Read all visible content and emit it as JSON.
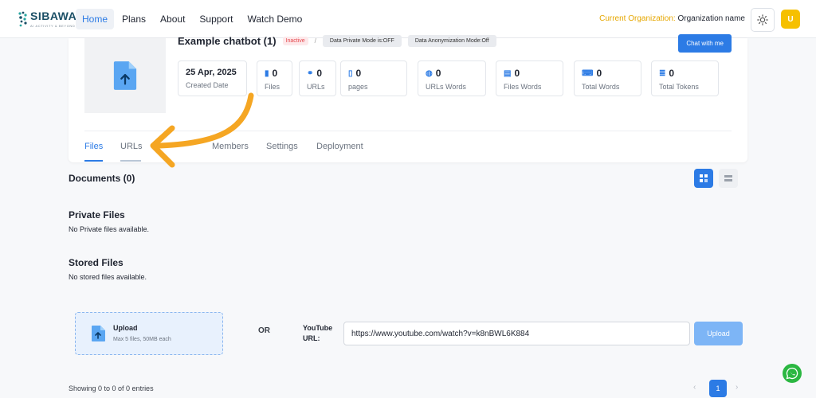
{
  "brand": {
    "name": "SIBAWAY",
    "tagline": "AI ACTIVITY & BEYOND"
  },
  "nav": [
    "Home",
    "Plans",
    "About",
    "Support",
    "Watch Demo"
  ],
  "nav_active": "Home",
  "org": {
    "label": "Current Organization:",
    "name": "Organization name"
  },
  "avatar": "U",
  "bot": {
    "title": "Example chatbot (1)",
    "status": "Inactive",
    "separator": "/",
    "private_mode": "Data Private Mode is:OFF",
    "anonymization": "Data Anonymization Mode:Off",
    "chat_button": "Chat with me"
  },
  "stats": [
    {
      "value": "25 Apr, 2025",
      "label": "Created Date",
      "icon": ""
    },
    {
      "value": "0",
      "label": "Files",
      "icon": "file-icon"
    },
    {
      "value": "0",
      "label": "URLs",
      "icon": "link-icon"
    },
    {
      "value": "0",
      "label": "pages",
      "icon": "page-icon"
    },
    {
      "value": "0",
      "label": "URLs Words",
      "icon": "globe-icon"
    },
    {
      "value": "0",
      "label": "Files Words",
      "icon": "word-doc-icon"
    },
    {
      "value": "0",
      "label": "Total Words",
      "icon": "keyboard-icon"
    },
    {
      "value": "0",
      "label": "Total Tokens",
      "icon": "database-icon"
    }
  ],
  "tabs": [
    "Files",
    "URLs",
    "Members",
    "Settings",
    "Deployment"
  ],
  "tab_active": "Files",
  "documents": {
    "title": "Documents (0)"
  },
  "private_files": {
    "title": "Private Files",
    "empty": "No Private files available."
  },
  "stored_files": {
    "title": "Stored Files",
    "empty": "No stored files available."
  },
  "upload": {
    "title": "Upload",
    "subtitle": "Max 5 files, 50MB each",
    "or": "OR",
    "youtube_label": "YouTube URL:",
    "youtube_value": "https://www.youtube.com/watch?v=k8nBWL6K884",
    "button": "Upload"
  },
  "pagination": {
    "summary": "Showing 0 to 0 of 0 entries",
    "prev": "‹",
    "current": "1",
    "next": "›"
  },
  "colors": {
    "accent": "#2c7be5",
    "warning": "#e6a700",
    "danger": "#e5484d",
    "whatsapp": "#2bb741",
    "annotation_arrow": "#f5a623"
  }
}
